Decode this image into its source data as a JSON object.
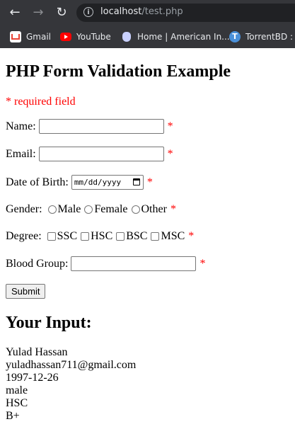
{
  "browser": {
    "back_icon": "arrow-left-icon",
    "forward_icon": "arrow-right-icon",
    "reload_icon": "reload-icon",
    "url_host": "localhost",
    "url_path": "/test.php",
    "bookmarks": [
      {
        "label": "Gmail",
        "icon": "gmail-icon"
      },
      {
        "label": "YouTube",
        "icon": "youtube-icon"
      },
      {
        "label": "Home | American In...",
        "icon": "home-icon"
      },
      {
        "label": "TorrentBD : H",
        "icon": "torrentbd-icon"
      }
    ]
  },
  "page": {
    "title": "PHP Form Validation Example",
    "required_note": "* required field",
    "star": "*",
    "name_label": "Name:",
    "email_label": "Email:",
    "dob_label": "Date of Birth:",
    "dob_placeholder": "mm/dd/yyyy",
    "gender_label": "Gender:",
    "gender_options": [
      "Male",
      "Female",
      "Other"
    ],
    "degree_label": "Degree:",
    "degree_options": [
      "SSC",
      "HSC",
      "BSC",
      "MSC"
    ],
    "blood_label": "Blood Group:",
    "submit_label": "Submit",
    "output_title": "Your Input:",
    "output_lines": [
      "Yulad Hassan",
      "yuladhassan711@gmail.com",
      "1997-12-26",
      "male",
      "HSC",
      "B+"
    ]
  }
}
